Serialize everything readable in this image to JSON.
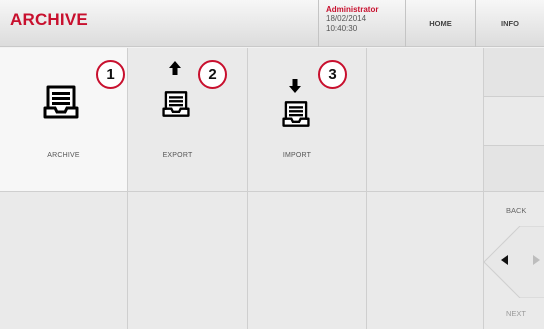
{
  "header": {
    "title": "ARCHIVE",
    "user": "Administrator",
    "date": "18/02/2014",
    "time": "10:40:30",
    "home_label": "HOME",
    "info_label": "INFO"
  },
  "menu": [
    {
      "label": "ARCHIVE",
      "badge": "1"
    },
    {
      "label": "EXPORT",
      "badge": "2"
    },
    {
      "label": "IMPORT",
      "badge": "3"
    }
  ],
  "side": {
    "back_label": "BACK",
    "next_label": "NEXT"
  },
  "colors": {
    "accent": "#c8102e",
    "background": "#eaeaea"
  }
}
